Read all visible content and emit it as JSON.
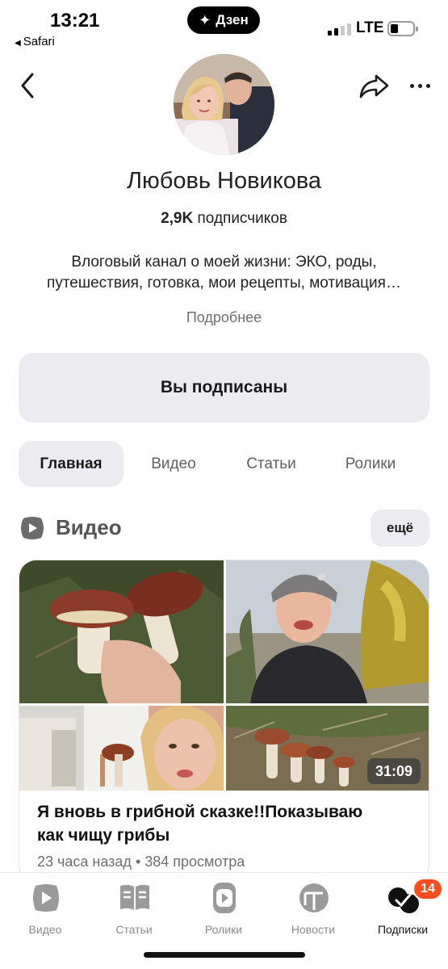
{
  "status_bar": {
    "time": "13:21",
    "back_app": "Safari",
    "center_pill": "Дзен",
    "network": "LTE"
  },
  "header": {
    "back_icon": "chevron-left-icon",
    "share_icon": "share-arrow-icon",
    "more_icon": "more-dots-icon"
  },
  "channel": {
    "name": "Любовь Новикова",
    "subscribers_count": "2,9K",
    "subscribers_label": "подписчиков",
    "description_line1": "Влоговый канал о моей жизни: ЭКО, роды,",
    "description_line2": "путешествия, готовка, мои рецепты, мотивация…",
    "more_link": "Подробнее",
    "subscribe_state": "Вы подписаны"
  },
  "tabs": [
    {
      "label": "Главная",
      "active": true
    },
    {
      "label": "Видео",
      "active": false
    },
    {
      "label": "Статьи",
      "active": false
    },
    {
      "label": "Ролики",
      "active": false
    }
  ],
  "video_section": {
    "title": "Видео",
    "more_button": "ещё"
  },
  "video_card": {
    "duration": "31:09",
    "title_line1": "Я вновь в грибной сказке!!Показываю",
    "title_line2": "как чищу грибы",
    "meta": "23 часа назад • 384 просмотра"
  },
  "bottom_nav": [
    {
      "label": "Видео",
      "icon": "video-play-icon",
      "active": false
    },
    {
      "label": "Статьи",
      "icon": "articles-book-icon",
      "active": false
    },
    {
      "label": "Ролики",
      "icon": "shorts-icon",
      "active": false
    },
    {
      "label": "Новости",
      "icon": "news-icon",
      "active": false
    },
    {
      "label": "Подписки",
      "icon": "subscriptions-check-icon",
      "active": true,
      "badge": "14"
    }
  ],
  "colors": {
    "accent_badge": "#ff4e1d",
    "button_bg": "#ebebf0",
    "muted_text": "#6e6e6e"
  }
}
